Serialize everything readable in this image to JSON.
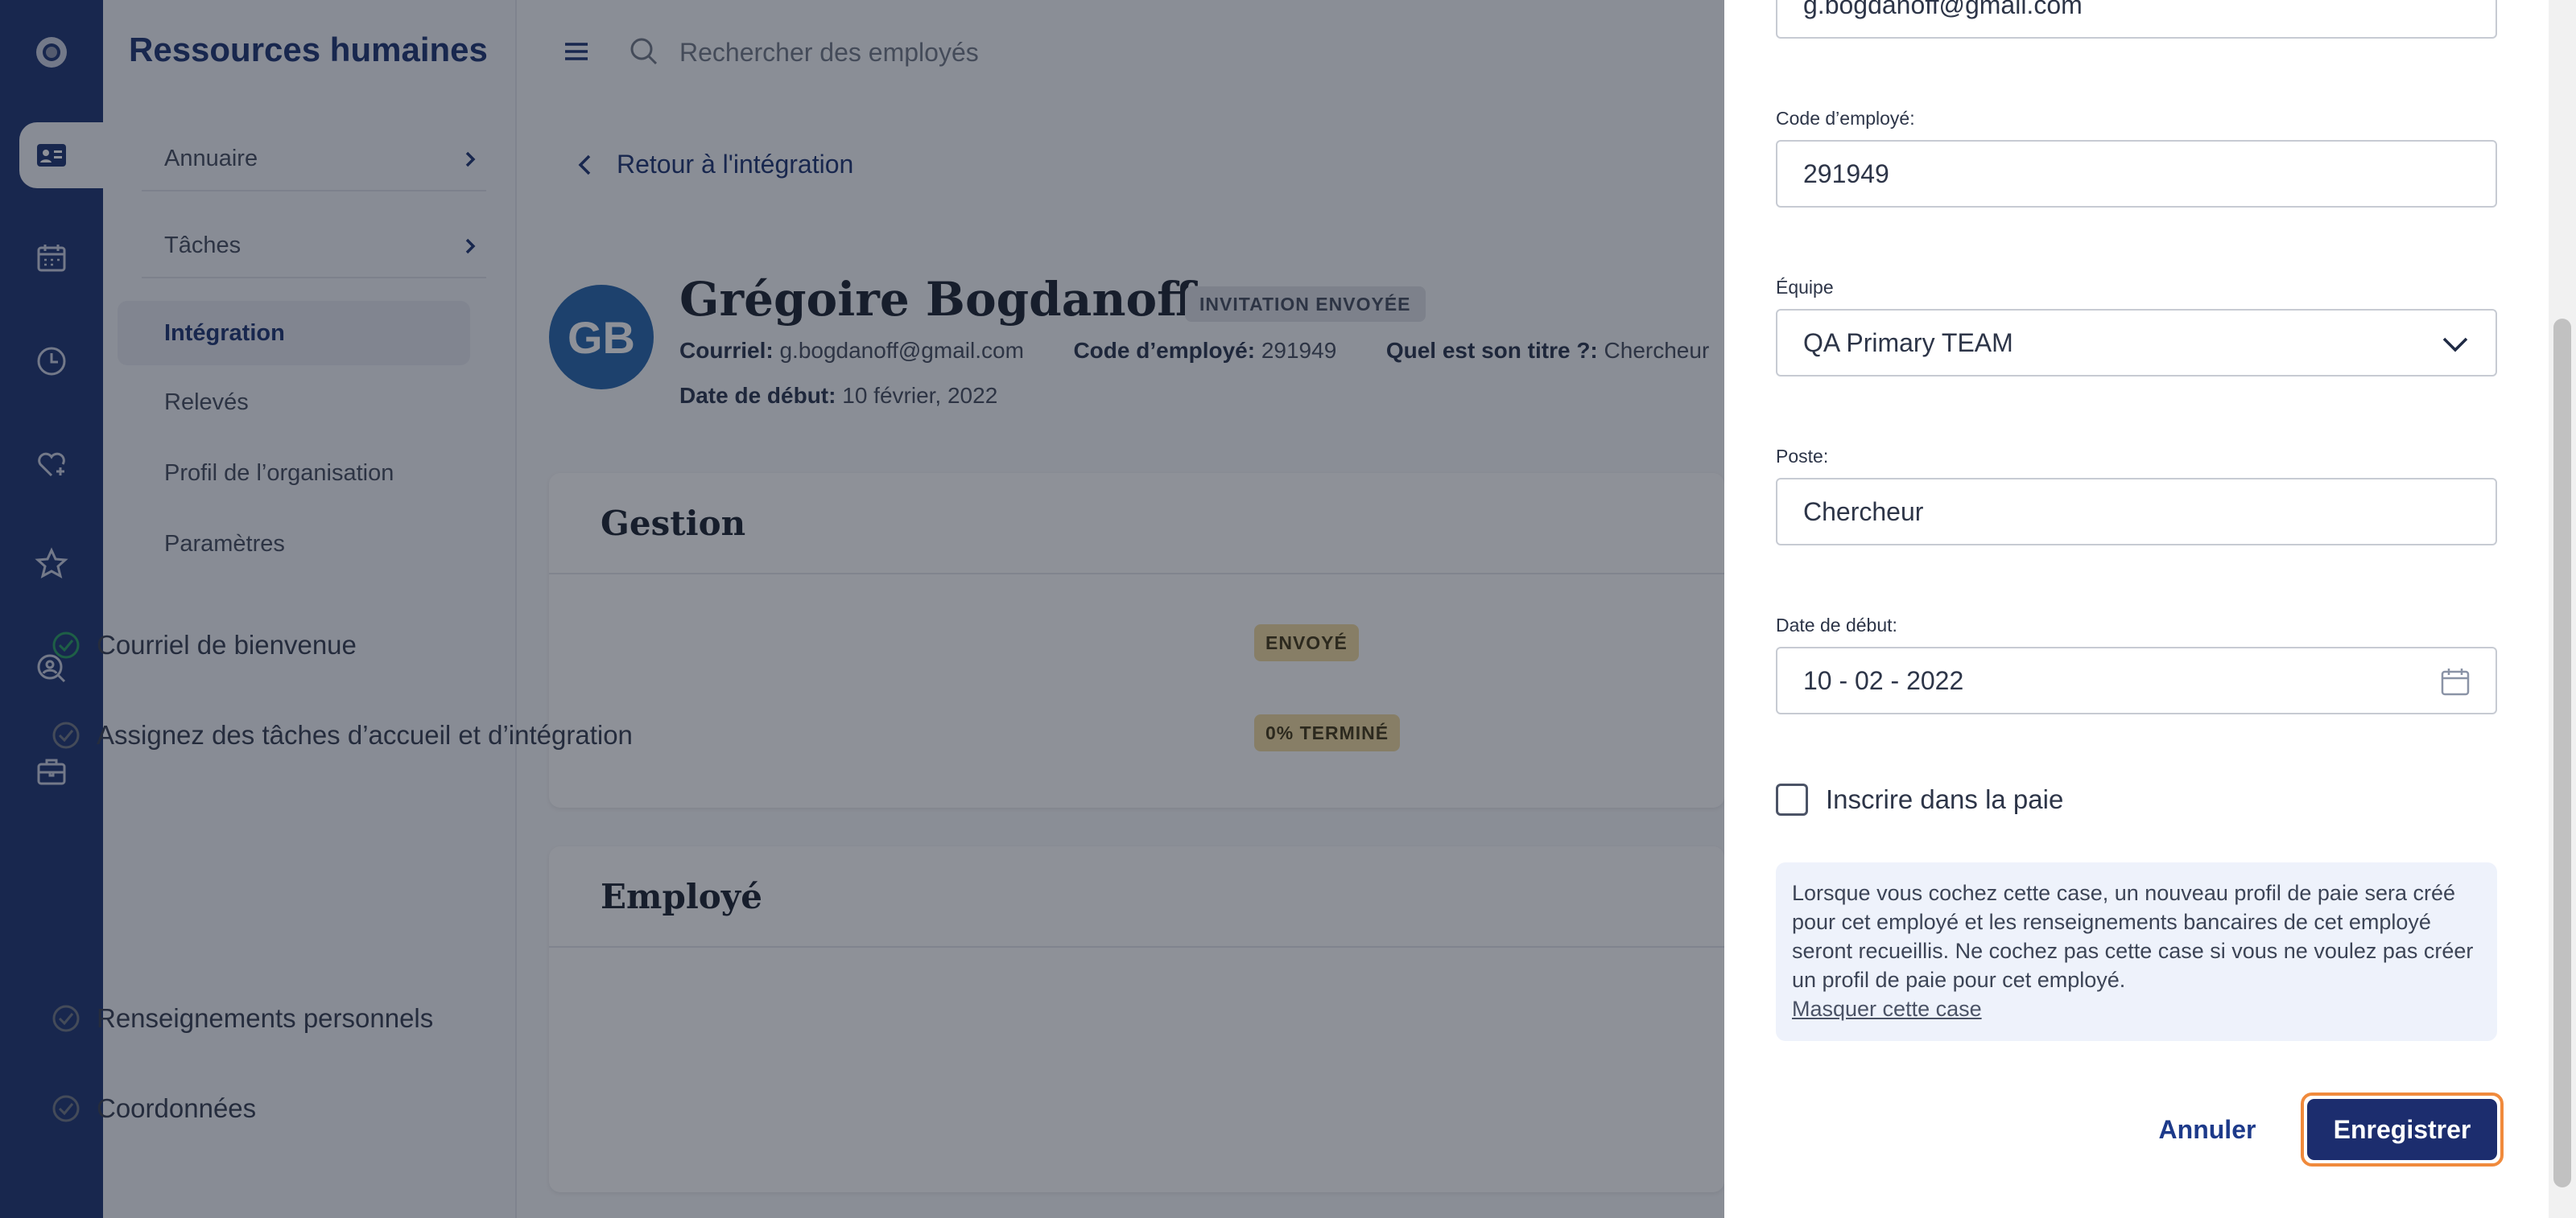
{
  "app": {
    "title": "Ressources humaines"
  },
  "nav": {
    "items": [
      {
        "label": "Annuaire",
        "has_chevron": true
      },
      {
        "label": "Tâches",
        "has_chevron": true
      },
      {
        "label": "Intégration",
        "active": true
      },
      {
        "label": "Relevés"
      },
      {
        "label": "Profil de l’organisation"
      },
      {
        "label": "Paramètres"
      }
    ]
  },
  "rail": {
    "icons": [
      "logo-icon",
      "people-card-icon",
      "calendar-icon",
      "clock-icon",
      "heart-plus-icon",
      "star-icon",
      "search-person-icon",
      "briefcase-icon"
    ],
    "active": "people-card-icon"
  },
  "search": {
    "placeholder": "Rechercher des employés"
  },
  "back": {
    "label": "Retour à l'intégration"
  },
  "employee": {
    "initials": "GB",
    "name": "Grégoire Bogdanoff",
    "status_badge": "INVITATION ENVOYÉE",
    "email_label": "Courriel:",
    "email": "g.bogdanoff@gmail.com",
    "code_label": "Code d’employé:",
    "code": "291949",
    "title_label": "Quel est son titre ?:",
    "title": "Chercheur",
    "start_label": "Date de début:",
    "start": "10 février, 2022"
  },
  "gestion": {
    "title": "Gestion",
    "tasks": [
      {
        "label": "Courriel de bienvenue",
        "badge": "ENVOYÉ",
        "done": true
      },
      {
        "label": "Assignez des tâches d’accueil et d’intégration",
        "badge": "0% TERMINÉ",
        "done": false
      }
    ]
  },
  "employe_section": {
    "title": "Employé",
    "tasks": [
      {
        "label": "Renseignements personnels"
      },
      {
        "label": "Coordonnées"
      }
    ]
  },
  "drawer": {
    "email_value": "g.bogdanoff@gmail.com",
    "code_label": "Code d’employé:",
    "code_value": "291949",
    "team_label": "Équipe",
    "team_value": "QA Primary TEAM",
    "position_label": "Poste:",
    "position_value": "Chercheur",
    "date_label": "Date de début:",
    "date_value": "10 - 02 - 2022",
    "payroll_label": "Inscrire dans la paie",
    "payroll_checked": false,
    "info_text": "Lorsque vous cochez cette case, un nouveau profil de paie sera créé pour cet employé et les renseignements bancaires de cet employé seront recueillis. Ne cochez pas cette case si vous ne voulez pas créer un profil de paie pour cet employé.",
    "info_link": "Masquer cette case",
    "cancel_label": "Annuler",
    "save_label": "Enregistrer"
  },
  "colors": {
    "rail_bg": "#132a6b",
    "accent": "#1c2d6e",
    "focus_outline": "#f08a3c",
    "badge_yellow": "#f0d99a",
    "avatar_bg": "#1d5fa8"
  }
}
